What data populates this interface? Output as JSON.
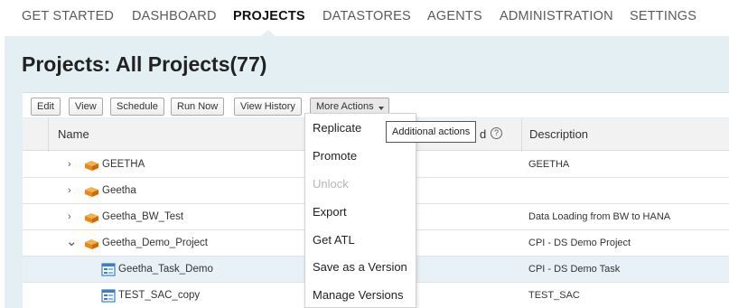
{
  "nav": {
    "items": [
      "GET STARTED",
      "DASHBOARD",
      "PROJECTS",
      "DATASTORES",
      "AGENTS",
      "ADMINISTRATION",
      "SETTINGS"
    ],
    "active": "PROJECTS"
  },
  "page": {
    "title": "Projects: All Projects(77)"
  },
  "toolbar": {
    "buttons": [
      "Edit",
      "View",
      "Schedule",
      "Run Now",
      "View History"
    ],
    "more_label": "More Actions"
  },
  "table": {
    "headers": {
      "name": "Name",
      "hidden_fragment": "d",
      "description": "Description"
    },
    "rows": [
      {
        "name": "GEETHA",
        "description": "GEETHA",
        "type": "project",
        "expander": "›"
      },
      {
        "name": "Geetha",
        "description": "",
        "type": "project",
        "expander": "›"
      },
      {
        "name": "Geetha_BW_Test",
        "description": "Data Loading from BW to HANA",
        "type": "project",
        "expander": "›"
      },
      {
        "name": "Geetha_Demo_Project",
        "description": "CPI - DS Demo Project",
        "type": "project",
        "expander": "⌄"
      },
      {
        "name": "Geetha_Task_Demo",
        "description": "CPI - DS Demo Task",
        "type": "task",
        "selected": true
      },
      {
        "name": "TEST_SAC_copy",
        "description": "TEST_SAC",
        "type": "task"
      }
    ]
  },
  "menu": {
    "items": [
      {
        "label": "Replicate",
        "enabled": true
      },
      {
        "label": "Promote",
        "enabled": true
      },
      {
        "label": "Unlock",
        "enabled": false
      },
      {
        "label": "Export",
        "enabled": true
      },
      {
        "label": "Get ATL",
        "enabled": true
      },
      {
        "label": "Save as a Version",
        "enabled": true
      },
      {
        "label": "Manage Versions",
        "enabled": true
      }
    ]
  },
  "tooltip": {
    "text": "Additional actions"
  },
  "colors": {
    "panel_bg": "#e4eff3",
    "selected_row": "#e8f1f8",
    "folder_orange": "#e8891c",
    "task_blue": "#3b7fc4"
  },
  "icons": {
    "project": "folder-stack-icon",
    "task": "task-icon",
    "help": "help-circle-icon"
  }
}
